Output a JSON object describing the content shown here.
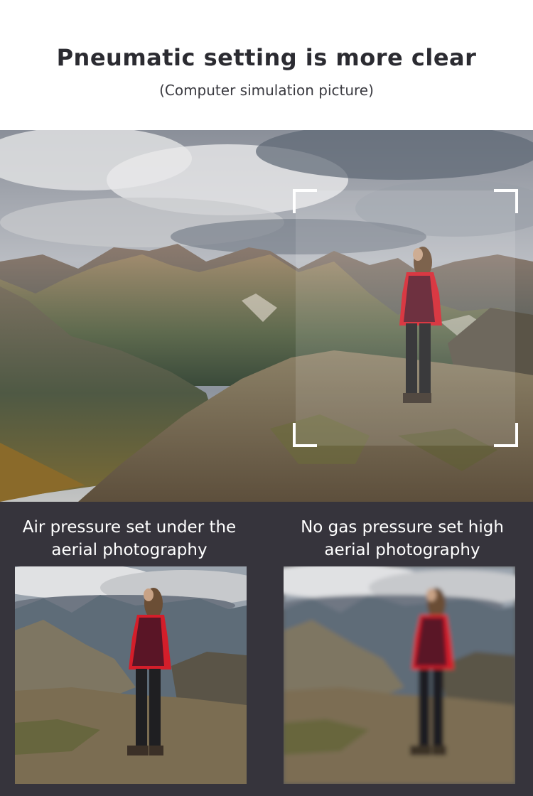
{
  "header": {
    "title": "Pneumatic setting is more clear",
    "subtitle": "(Computer simulation picture)"
  },
  "comparison": {
    "left_caption_line1": "Air pressure set under the",
    "left_caption_line2": "aerial photography",
    "right_caption_line1": "No gas pressure set high",
    "right_caption_line2": "aerial photography"
  },
  "colors": {
    "panel_background": "#36343c",
    "title_text": "#2b2b31",
    "jacket_red": "#d41e2a",
    "vest_maroon": "#5a1526"
  }
}
